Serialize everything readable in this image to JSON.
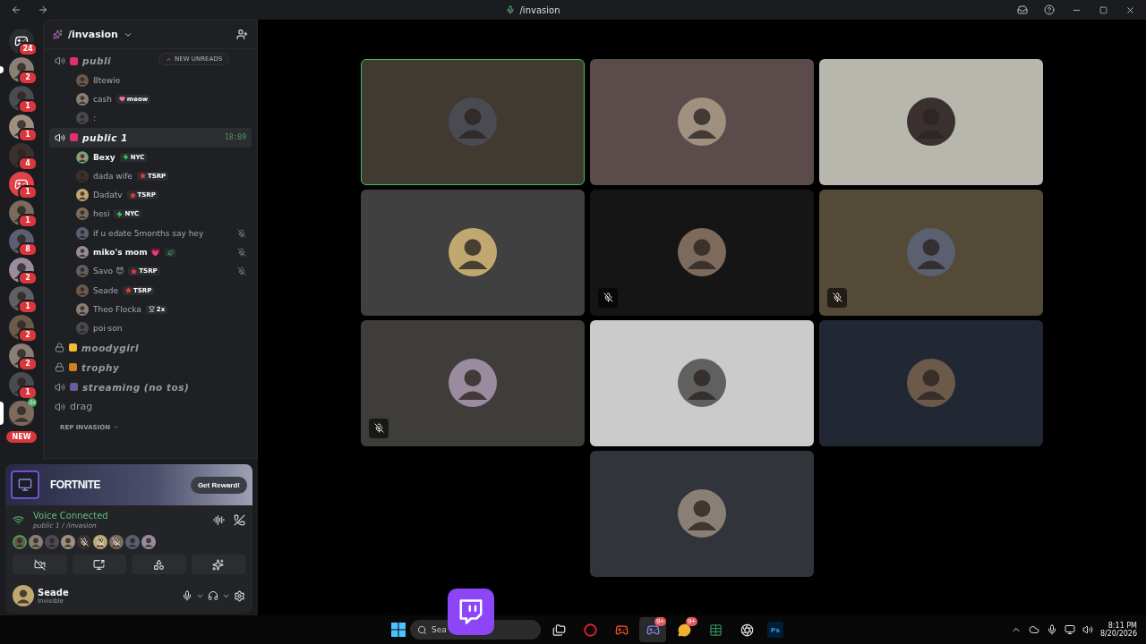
{
  "titlebar": {
    "title": "/invasion"
  },
  "servers": [
    {
      "kind": "home",
      "badge": "24",
      "unread": false,
      "selected": false
    },
    {
      "kind": "avatar",
      "badge": "2",
      "unread": true,
      "selected": false
    },
    {
      "kind": "avatar",
      "badge": "1",
      "unread": false,
      "selected": false
    },
    {
      "kind": "avatar",
      "badge": "1",
      "unread": false,
      "selected": false
    },
    {
      "kind": "avatar",
      "badge": "4",
      "unread": false,
      "selected": false
    },
    {
      "kind": "discord",
      "badge": "1",
      "unread": false,
      "selected": false
    },
    {
      "kind": "avatar",
      "badge": "1",
      "unread": false,
      "selected": false
    },
    {
      "kind": "avatar",
      "badge": "8",
      "unread": false,
      "selected": false
    },
    {
      "kind": "avatar",
      "badge": "2",
      "unread": false,
      "selected": false
    },
    {
      "kind": "avatar",
      "badge": "1",
      "unread": false,
      "selected": false
    },
    {
      "kind": "avatar",
      "badge": "2",
      "unread": false,
      "selected": false
    },
    {
      "kind": "avatar",
      "badge": "2",
      "unread": false,
      "selected": false
    },
    {
      "kind": "avatar",
      "badge": "1",
      "unread": false,
      "selected": false
    },
    {
      "kind": "voice",
      "unread": false,
      "selected": true
    }
  ],
  "new_pill": "NEW",
  "server_header": {
    "name": "/invasion"
  },
  "unreads_pill": "NEW UNREADS",
  "channels": [
    {
      "kind": "voice",
      "name": "publi",
      "fancy": true,
      "selected": false,
      "members": [
        {
          "name": "8tewie",
          "bright": false,
          "speaking": false,
          "muted": false
        },
        {
          "name": "cash",
          "bright": false,
          "speaking": false,
          "muted": false,
          "tag": {
            "kind": "heart",
            "text": "meow"
          }
        },
        {
          "name": ":",
          "bright": false,
          "speaking": false,
          "muted": false
        }
      ]
    },
    {
      "kind": "voice",
      "name": "public 1",
      "fancy": true,
      "selected": true,
      "time": "18:09",
      "members": [
        {
          "name": "Bexy",
          "bright": true,
          "speaking": true,
          "muted": false,
          "tag": {
            "kind": "bolt",
            "text": "NYC"
          }
        },
        {
          "name": "dada wife",
          "bright": false,
          "speaking": false,
          "muted": false,
          "tag": {
            "kind": "star",
            "text": "TSRP"
          }
        },
        {
          "name": "Dadatv",
          "bright": false,
          "speaking": false,
          "muted": false,
          "tag": {
            "kind": "star",
            "text": "TSRP"
          }
        },
        {
          "name": "hesi",
          "bright": false,
          "speaking": false,
          "muted": false,
          "tag": {
            "kind": "bolt",
            "text": "NYC"
          }
        },
        {
          "name": "if u edate 5months say hey",
          "bright": false,
          "speaking": false,
          "muted": true
        },
        {
          "name": "miko's mom 💗",
          "bright": true,
          "speaking": false,
          "muted": true,
          "tag": {
            "kind": "leaf"
          }
        },
        {
          "name": "Savo 😈",
          "bright": false,
          "speaking": false,
          "muted": true,
          "tag": {
            "kind": "star",
            "text": "TSRP"
          }
        },
        {
          "name": "Seade",
          "bright": false,
          "speaking": false,
          "muted": false,
          "tag": {
            "kind": "star",
            "text": "TSRP"
          }
        },
        {
          "name": "Theo Flocka",
          "bright": false,
          "speaking": false,
          "muted": false,
          "tag": {
            "kind": "trophy",
            "text": "2x"
          }
        },
        {
          "name": "poi·son",
          "bright": false,
          "speaking": false,
          "muted": false
        }
      ]
    },
    {
      "kind": "locked",
      "name": "moodygirl",
      "fancy": true,
      "selected": false
    },
    {
      "kind": "locked",
      "name": "trophy",
      "fancy": true,
      "selected": false
    },
    {
      "kind": "voice",
      "name": "streaming (no tos)",
      "fancy": true,
      "selected": false
    },
    {
      "kind": "voice",
      "name": "drag",
      "fancy": false,
      "selected": false
    }
  ],
  "category": "REP INVASION",
  "promo": {
    "logo": "FORTNITE",
    "button": "Get Reward!"
  },
  "voice": {
    "status": "Voice Connected",
    "channel": "public 1 / /invasion",
    "participants": [
      {
        "muted": false
      },
      {
        "muted": false
      },
      {
        "muted": false
      },
      {
        "muted": false
      },
      {
        "muted": true
      },
      {
        "muted": true
      },
      {
        "muted": true
      },
      {
        "muted": false
      },
      {
        "muted": false
      }
    ]
  },
  "user": {
    "name": "Seade",
    "status": "Invisible"
  },
  "tiles": [
    {
      "color": "#403a31",
      "selected": true,
      "muted": false
    },
    {
      "color": "#5c4b4b",
      "selected": false,
      "muted": false
    },
    {
      "color": "#b7b7ad",
      "selected": false,
      "muted": false
    },
    {
      "color": "#404040",
      "selected": false,
      "muted": false
    },
    {
      "color": "#151515",
      "selected": false,
      "muted": true
    },
    {
      "color": "#534a37",
      "selected": false,
      "muted": true
    },
    {
      "color": "#3e3d3a",
      "selected": false,
      "muted": true
    },
    {
      "color": "#cbcbcb",
      "selected": false,
      "muted": false
    },
    {
      "color": "#222833",
      "selected": false,
      "muted": false
    },
    {
      "color": "#32343c",
      "selected": false,
      "muted": false
    }
  ],
  "taskbar": {
    "search": "Sea",
    "apps": [
      {
        "kind": "files",
        "selected": false
      },
      {
        "kind": "opera",
        "selected": false
      },
      {
        "kind": "brave",
        "selected": false
      },
      {
        "kind": "discord",
        "badge": "9+",
        "selected": true
      },
      {
        "kind": "chat",
        "badge": "9+",
        "selected": false
      },
      {
        "kind": "excel",
        "selected": false
      },
      {
        "kind": "obs",
        "selected": false
      },
      {
        "kind": "ps",
        "text": "Ps",
        "selected": false
      }
    ],
    "time": "8:11 PM",
    "date": "8/20/2026"
  }
}
